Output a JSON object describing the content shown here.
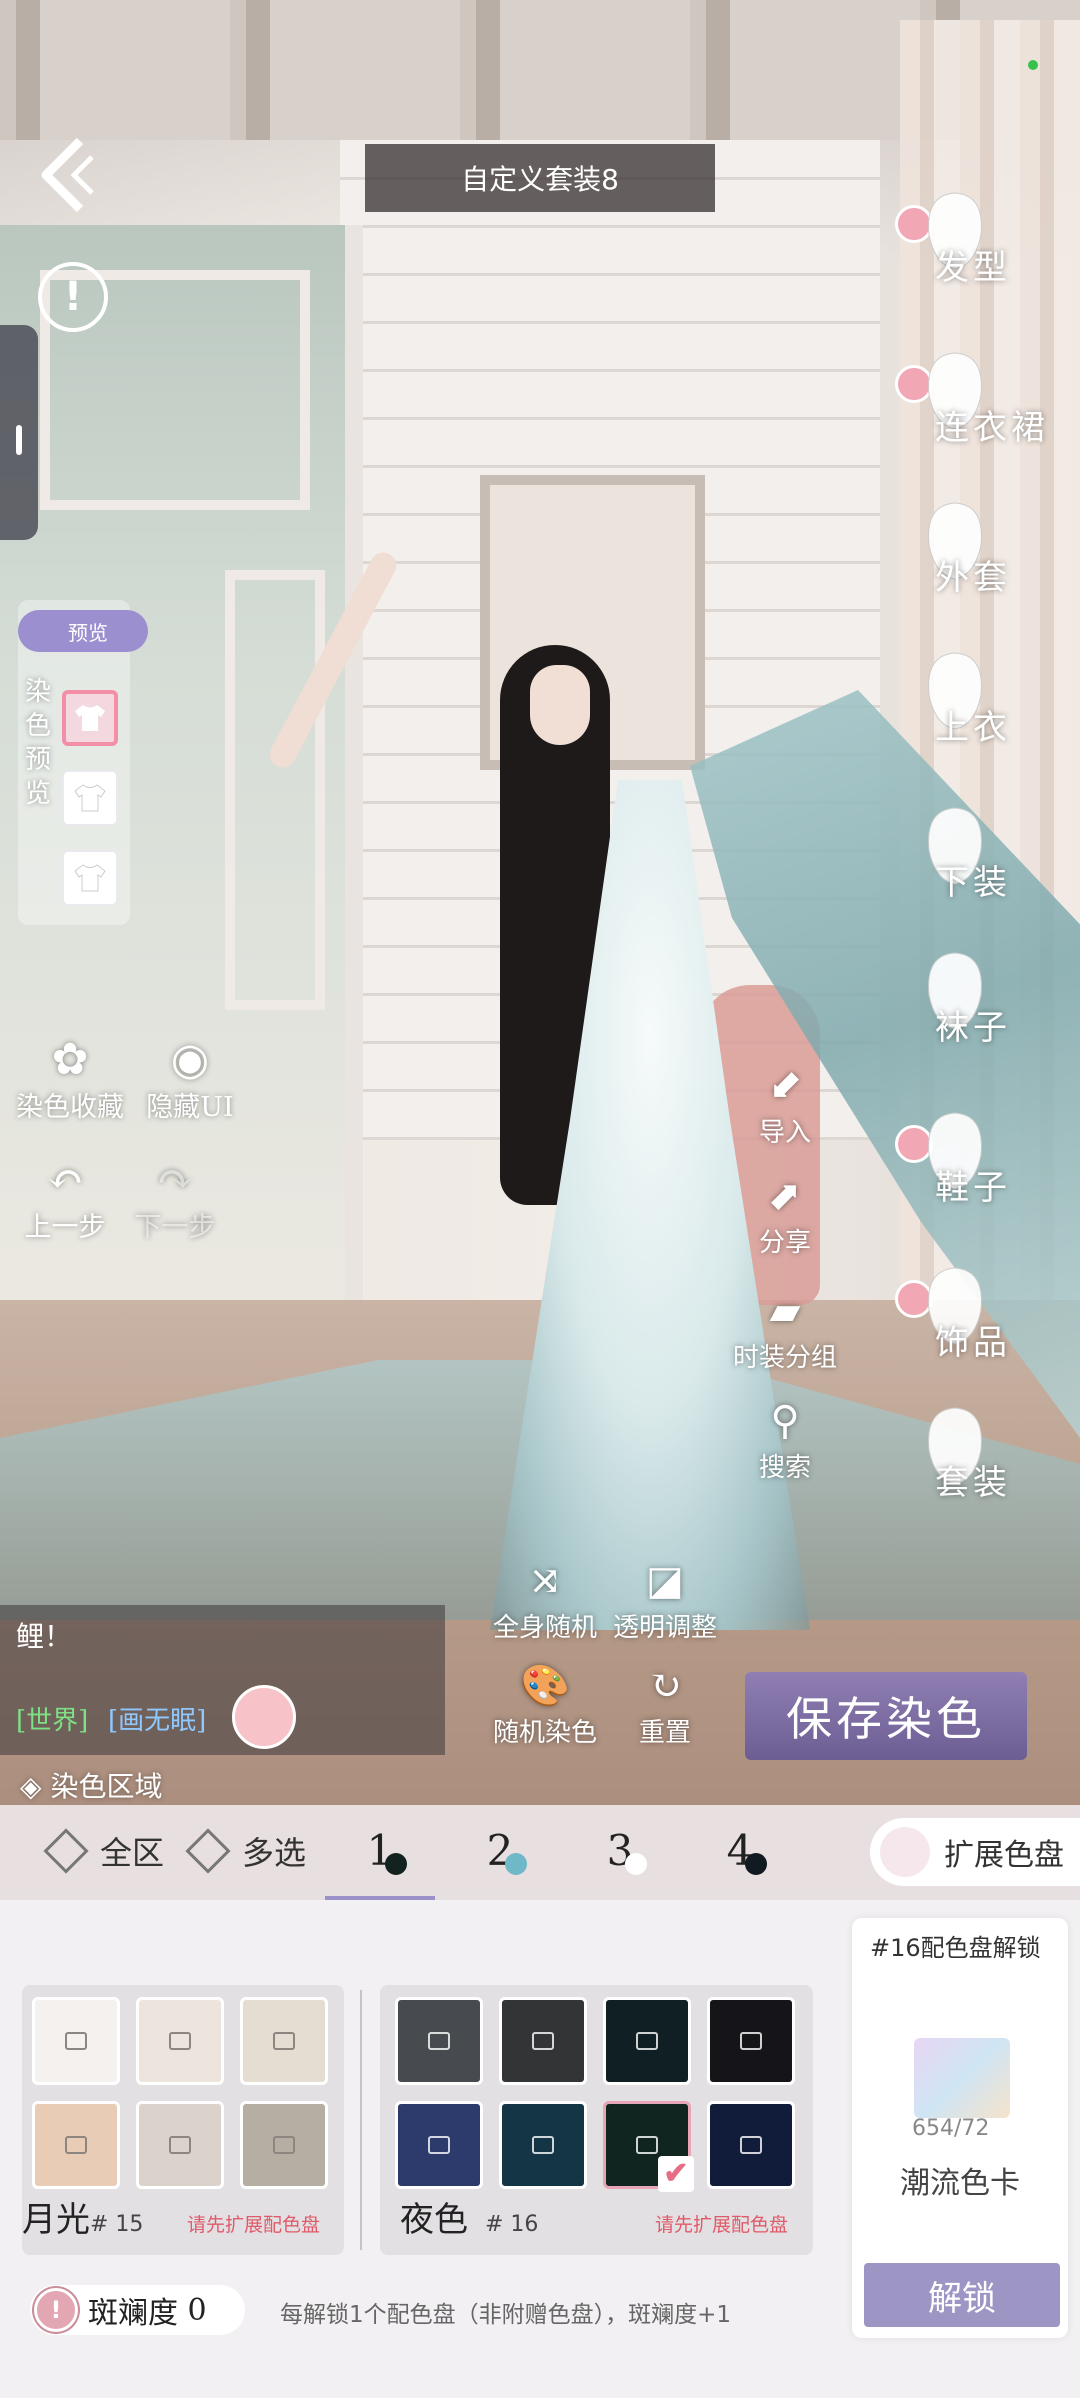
{
  "title": "自定义套装8",
  "categories": [
    {
      "label": "发型",
      "icon": "hair-icon",
      "badge": true
    },
    {
      "label": "连衣裙",
      "icon": "dress-icon",
      "badge": true
    },
    {
      "label": "外套",
      "icon": "coat-icon",
      "badge": false
    },
    {
      "label": "上衣",
      "icon": "top-icon",
      "badge": false
    },
    {
      "label": "下装",
      "icon": "skirt-icon",
      "badge": false
    },
    {
      "label": "袜子",
      "icon": "socks-icon",
      "badge": false
    },
    {
      "label": "鞋子",
      "icon": "shoes-icon",
      "badge": true
    },
    {
      "label": "饰品",
      "icon": "accessory-icon",
      "badge": true
    },
    {
      "label": "套装",
      "icon": "suit-icon",
      "badge": false
    }
  ],
  "preview": {
    "tag": "预览",
    "label": "染色预览"
  },
  "left_tools": {
    "dye_favorites": "染色收藏",
    "hide_ui": "隐藏UI",
    "undo": "上一步",
    "redo": "下一步"
  },
  "mid_tools": {
    "import": "导入",
    "share": "分享",
    "group": "时装分组",
    "search": "搜索",
    "full_random": "全身随机",
    "transparency": "透明调整",
    "random_dye": "随机染色",
    "reset": "重置"
  },
  "chat": {
    "message": "鲤！",
    "channel": "[世界]",
    "user": "[画无眠]"
  },
  "save_label": "保存染色",
  "region": {
    "label": "染色区域",
    "all": "全区",
    "multi": "多选",
    "numbers": [
      "1",
      "2",
      "3",
      "4"
    ],
    "dot_colors": [
      "#12221f",
      "#6fb8c8",
      "#ffffff",
      "#111a20"
    ],
    "expand": "扩展色盘"
  },
  "palette_left": {
    "name": "月光",
    "code": "# 15",
    "warn": "请先扩展配色盘",
    "colors": [
      "#f4f1ee",
      "#ece4dd",
      "#e6ddd2",
      "#e8ccb6",
      "#dcd2cc",
      "#b6aea3"
    ]
  },
  "palette_right": {
    "name": "夜色",
    "code": "# 16",
    "warn": "请先扩展配色盘",
    "colors": [
      "#474b50",
      "#333436",
      "#0f1f24",
      "#151519",
      "#2c3a6c",
      "#133546",
      "#102420",
      "#101c3a"
    ]
  },
  "unlock": {
    "title": "#16配色盘解锁",
    "count": "654/72",
    "name": "潮流色卡",
    "button": "解锁"
  },
  "spot": {
    "label": "斑斓度",
    "value": "0"
  },
  "hint": "每解锁1个配色盘（非附赠色盘），斑斓度+1"
}
